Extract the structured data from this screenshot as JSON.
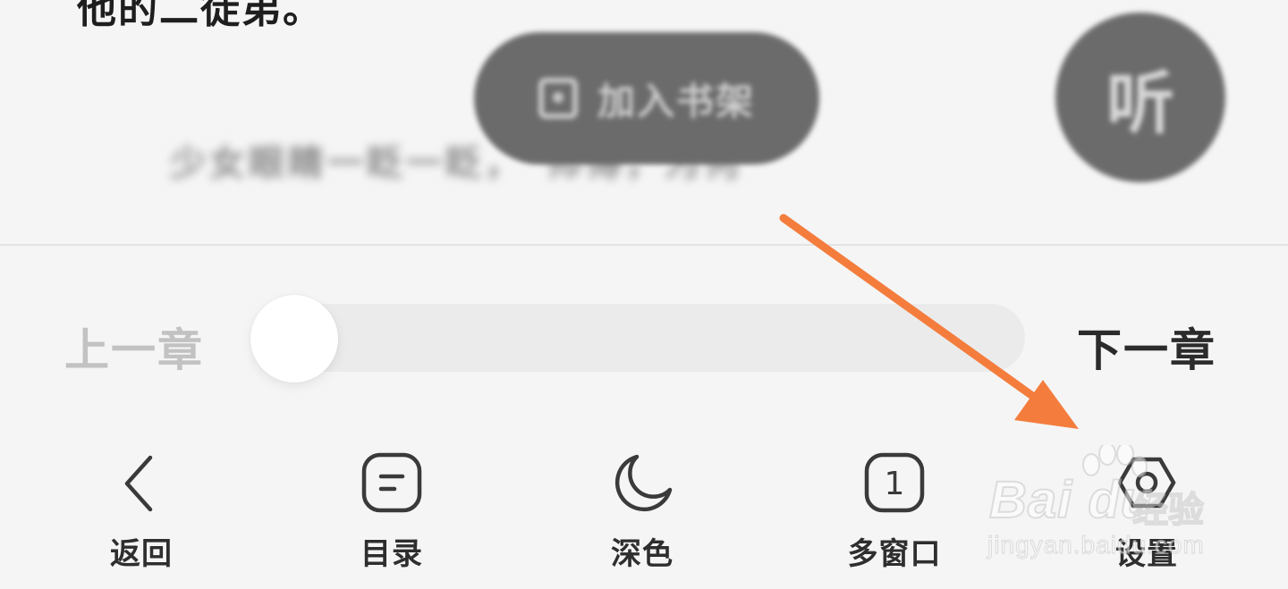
{
  "reader": {
    "partial_text_line": "他的二徒弟。",
    "blurred_text_line": "少女眼睛一眨一眨，\"师傅，为何",
    "add_to_bookshelf_label": "加入书架",
    "listen_label": "听"
  },
  "chapter_nav": {
    "prev_label": "上一章",
    "next_label": "下一章",
    "progress_fraction": 0.0
  },
  "toolbar": {
    "items": [
      {
        "label": "返回",
        "icon": "chevron-left-icon"
      },
      {
        "label": "目录",
        "icon": "catalog-icon"
      },
      {
        "label": "深色",
        "icon": "moon-icon"
      },
      {
        "label": "多窗口",
        "icon": "multi-window-icon"
      },
      {
        "label": "设置",
        "icon": "settings-hexagon-icon"
      }
    ],
    "multi_window_badge": "1"
  },
  "annotation": {
    "arrow_color": "#f47d3e"
  },
  "watermark": {
    "brand": "Bai du",
    "cn_text": "经验",
    "url": "jingyan.baidu.com"
  }
}
